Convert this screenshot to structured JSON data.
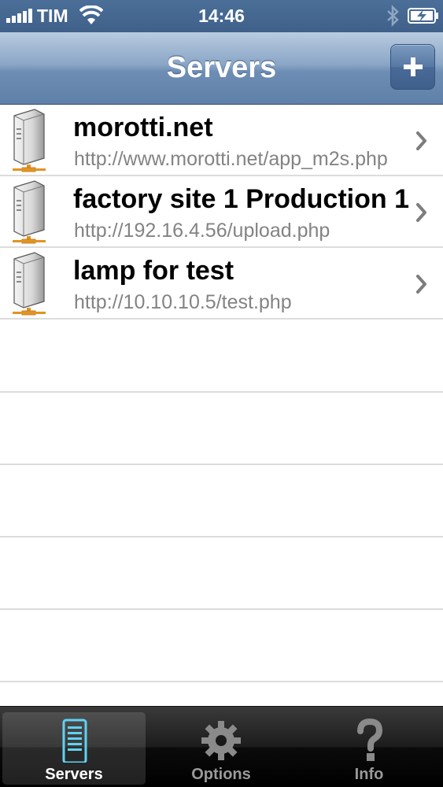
{
  "status_bar": {
    "carrier": "TIM",
    "time": "14:46"
  },
  "nav": {
    "title": "Servers",
    "add_label": "+"
  },
  "servers": [
    {
      "name": "morotti.net",
      "url": "http://www.morotti.net/app_m2s.php"
    },
    {
      "name": "factory site 1 Production 1",
      "url": "http://192.16.4.56/upload.php"
    },
    {
      "name": "lamp for test",
      "url": "http://10.10.10.5/test.php"
    }
  ],
  "tabs": [
    {
      "label": "Servers",
      "icon": "server-icon",
      "selected": true
    },
    {
      "label": "Options",
      "icon": "gear-icon",
      "selected": false
    },
    {
      "label": "Info",
      "icon": "question-icon",
      "selected": false
    }
  ],
  "colors": {
    "nav_accent": "#5f80a8",
    "selected_tab_icon": "#5fd3f3"
  }
}
